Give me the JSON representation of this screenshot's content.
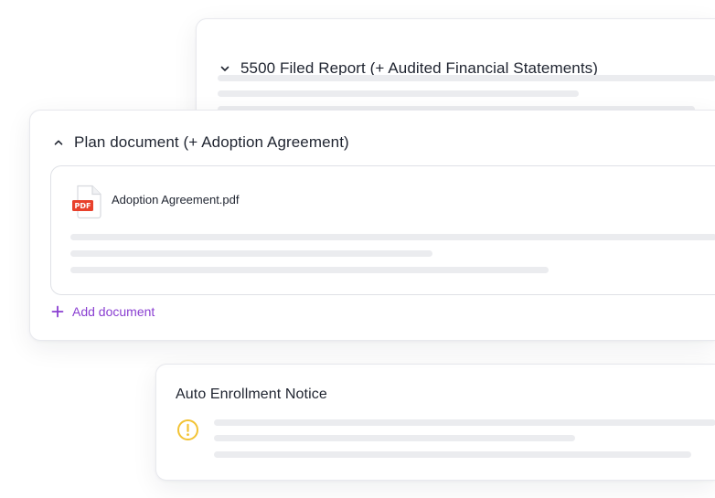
{
  "cards": {
    "report_5500": {
      "title": "5500 Filed Report (+ Audited Financial Statements)",
      "expanded": false
    },
    "plan_document": {
      "title": "Plan document (+ Adoption Agreement)",
      "expanded": true,
      "file": {
        "icon_label": "PDF",
        "name": "Adoption Agreement.pdf"
      },
      "add_label": "Add document"
    },
    "auto_enrollment": {
      "title": "Auto Enrollment Notice",
      "status_icon": "warning-icon"
    }
  },
  "colors": {
    "accent": "#8a3fd1",
    "pdf_red": "#e8412c",
    "warning": "#f2c335",
    "placeholder": "#ebecef",
    "border": "#e8e9ee"
  }
}
